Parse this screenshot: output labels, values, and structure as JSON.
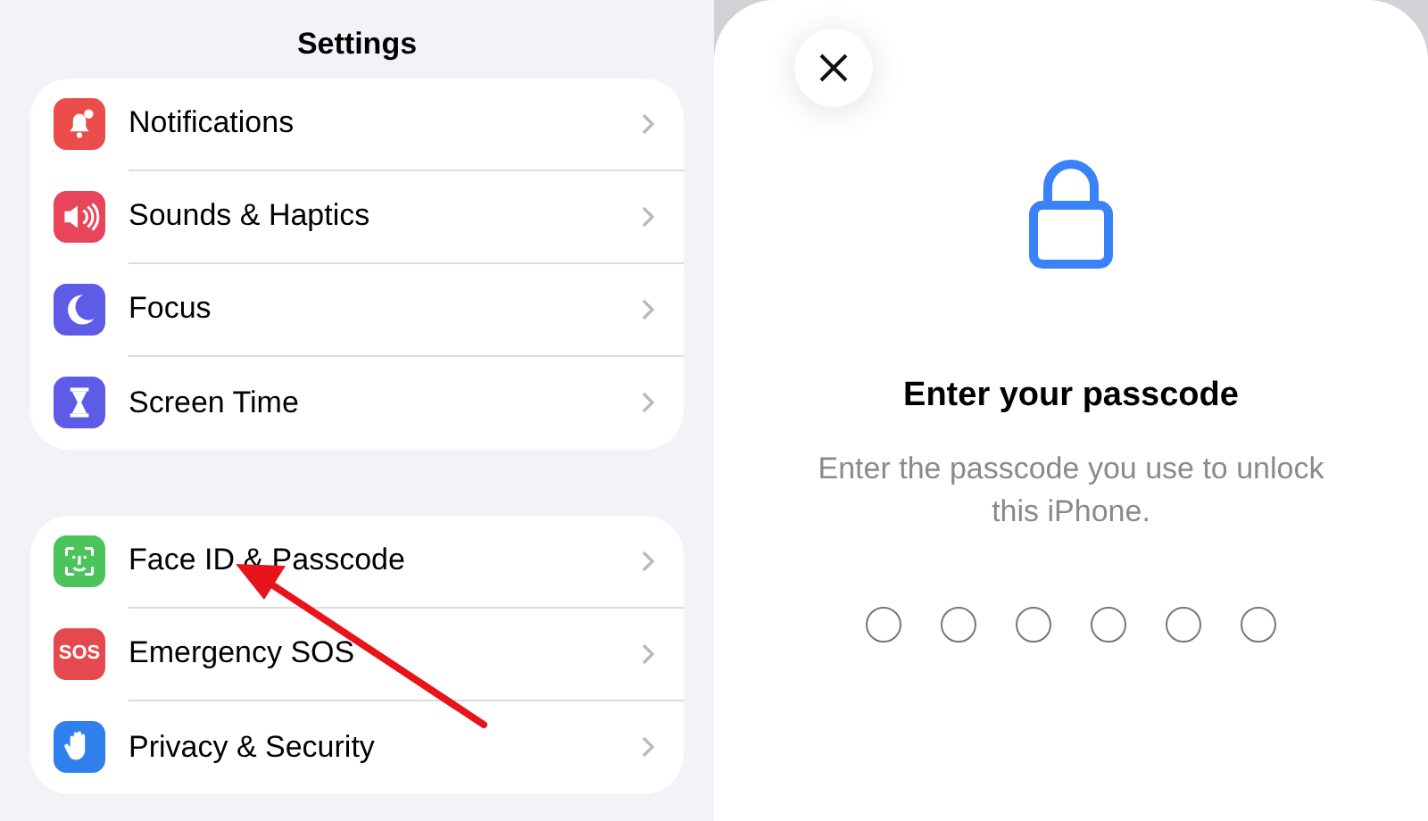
{
  "settings": {
    "title": "Settings",
    "groups": [
      {
        "items": [
          {
            "label": "Notifications",
            "kind": "bell",
            "color": "#eb4d4b"
          },
          {
            "label": "Sounds & Haptics",
            "kind": "speaker",
            "color": "#e8455a"
          },
          {
            "label": "Focus",
            "kind": "moon",
            "color": "#5e5ce6"
          },
          {
            "label": "Screen Time",
            "kind": "hourglass",
            "color": "#5e5ce6"
          }
        ]
      },
      {
        "items": [
          {
            "label": "Face ID & Passcode",
            "kind": "faceid",
            "color": "#4cc45c"
          },
          {
            "label": "Emergency SOS",
            "kind": "sos",
            "icon_text": "SOS",
            "color": "#e5484d"
          },
          {
            "label": "Privacy & Security",
            "kind": "hand",
            "color": "#2f80ed"
          }
        ]
      }
    ]
  },
  "passcode_sheet": {
    "title": "Enter your passcode",
    "message": "Enter the passcode you use to unlock this iPhone.",
    "digits": [
      {
        "filled": false
      },
      {
        "filled": false
      },
      {
        "filled": false
      },
      {
        "filled": false
      },
      {
        "filled": false
      },
      {
        "filled": false
      }
    ]
  }
}
